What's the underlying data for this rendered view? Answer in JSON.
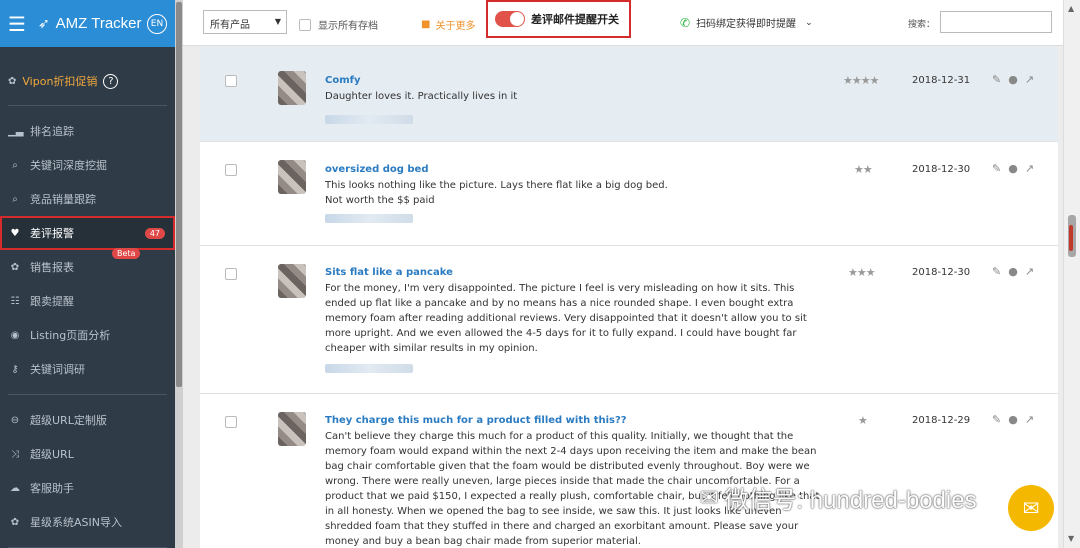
{
  "app": {
    "title": "AMZ Tracker",
    "lang": "EN"
  },
  "sidebar": {
    "vipon": "Vipon折扣促销",
    "help": "?",
    "items": [
      {
        "label": "排名追踪",
        "icon": "bar-chart-icon"
      },
      {
        "label": "关键词深度挖掘",
        "icon": "search-icon"
      },
      {
        "label": "竞品销量跟踪",
        "icon": "search-icon"
      },
      {
        "label": "差评报警",
        "icon": "heart-icon",
        "badge": "47",
        "active": true
      },
      {
        "label": "销售报表",
        "icon": "gift-icon",
        "tag": "Beta"
      },
      {
        "label": "跟卖提醒",
        "icon": "list-icon"
      },
      {
        "label": "Listing页面分析",
        "icon": "eye-icon"
      },
      {
        "label": "关键词调研",
        "icon": "key-icon"
      },
      {
        "label": "超级URL定制版",
        "icon": "link-icon"
      },
      {
        "label": "超级URL",
        "icon": "shuffle-icon"
      },
      {
        "label": "客服助手",
        "icon": "chat-icon"
      },
      {
        "label": "星级系统ASIN导入",
        "icon": "gift-icon"
      }
    ]
  },
  "topbar": {
    "product_select": "所有产品",
    "show_archived": "显示所有存档",
    "about_more": "关于更多",
    "toggle_label": "差评邮件提醒开关",
    "toggle_on": true,
    "wechat_label": "扫码绑定获得即时提醒",
    "search_label": "搜索：",
    "search_value": ""
  },
  "reviews": [
    {
      "title": "Comfy",
      "body": "Daughter loves it. Practically lives in it",
      "stars": "★★★★",
      "rating": 4,
      "date": "2018-12-31",
      "highlighted": true
    },
    {
      "title": "oversized dog bed",
      "body": "This looks nothing like the picture. Lays there flat like a big dog bed.\nNot worth the $$ paid",
      "stars": "★★",
      "rating": 2,
      "date": "2018-12-30"
    },
    {
      "title": "Sits flat like a pancake",
      "body": "For the money, I'm very disappointed. The picture I feel is very misleading on how it sits. This ended up flat like a pancake and by no means has a nice rounded shape. I even bought extra memory foam after reading additional reviews. Very disappointed that it doesn't allow you to sit more upright. And we even allowed the 4-5 days for it to fully expand. I could have bought far cheaper with similar results in my opinion.",
      "stars": "★★★",
      "rating": 3,
      "date": "2018-12-30"
    },
    {
      "title": "They charge this much for a product filled with this??",
      "body": "Can't believe they charge this much for a product of this quality. Initially, we thought that the memory foam would expand within the next 2-4 days upon receiving the item and make the bean bag chair comfortable given that the foam would be distributed evenly throughout. Boy were we wrong. There were really uneven, large pieces inside that made the chair uncomfortable. For a product that we paid $150, I expected a really plush, comfortable chair, but it felt nothing like that in all honesty. When we opened the bag to see inside, we saw this. It just looks like uneven shredded foam that they stuffed in there and charged an exorbitant amount. Please save your money and buy a bean bag chair made from superior material.",
      "stars": "★",
      "rating": 1,
      "date": "2018-12-29"
    }
  ],
  "watermark": "微信号: hundred-bodies"
}
